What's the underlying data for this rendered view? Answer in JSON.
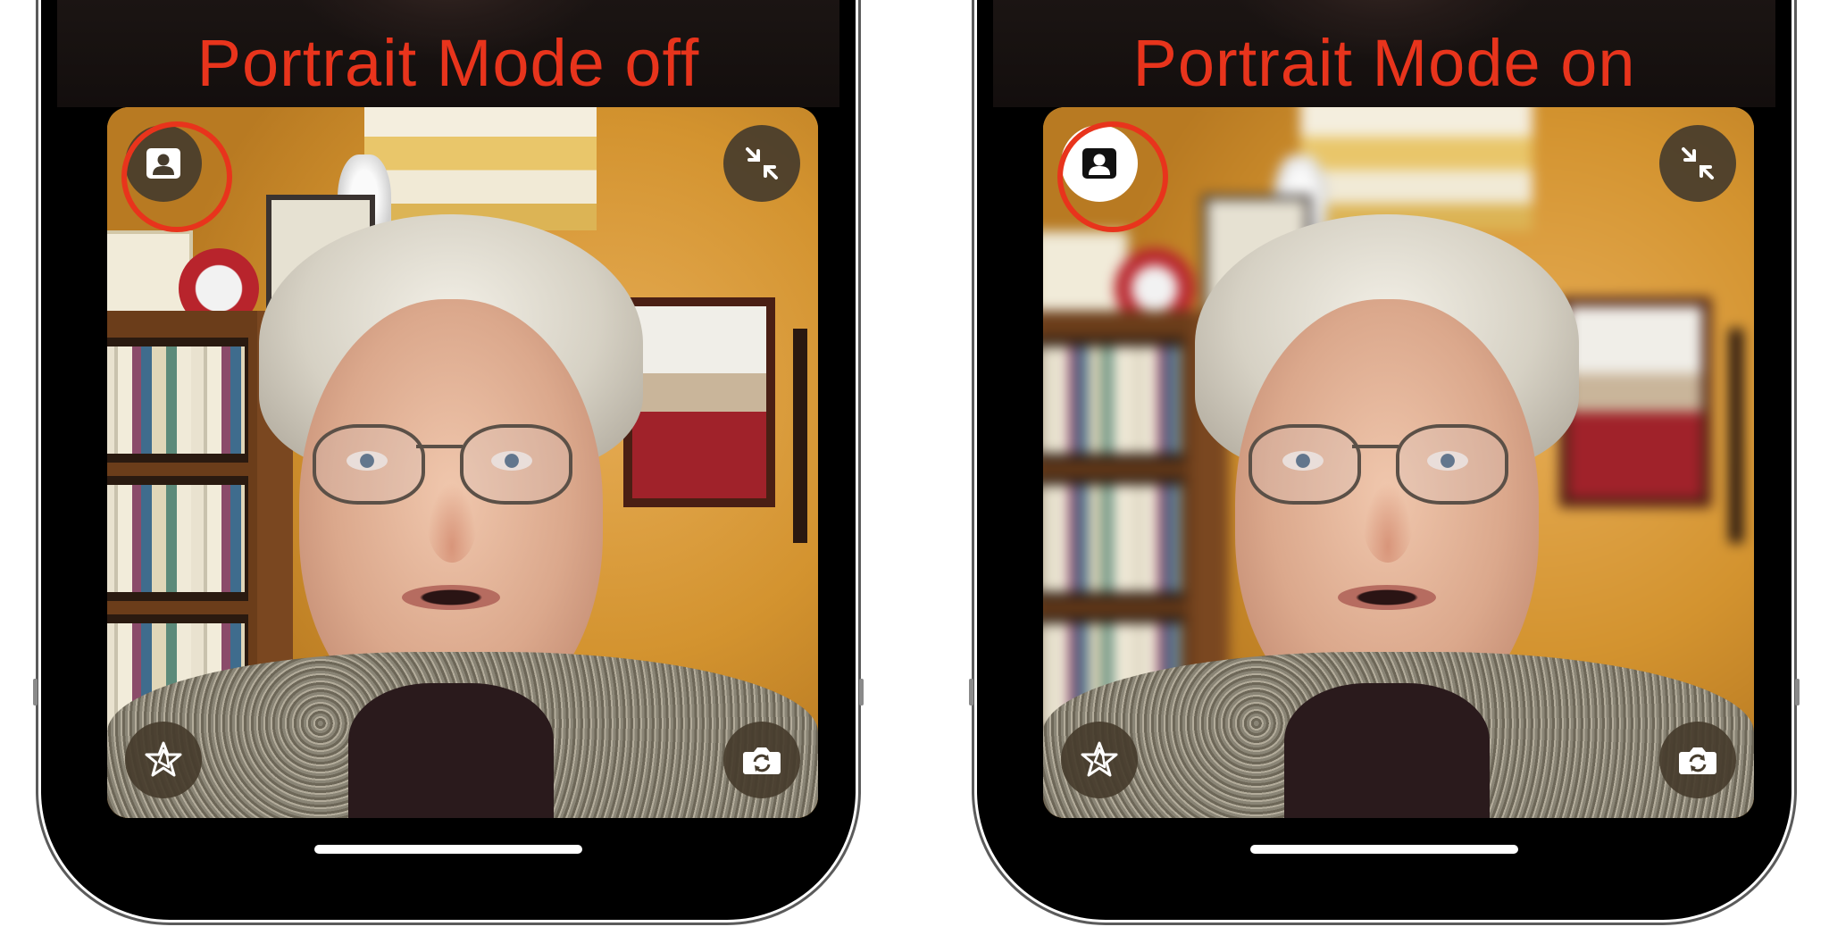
{
  "panels": [
    {
      "label": "Portrait Mode off",
      "portrait_active": false,
      "controls": {
        "portrait": "portrait-person-icon",
        "minimize": "minimize-arrows-icon",
        "effects": "effects-star-icon",
        "flip": "camera-flip-icon"
      }
    },
    {
      "label": "Portrait Mode on",
      "portrait_active": true,
      "controls": {
        "portrait": "portrait-person-icon",
        "minimize": "minimize-arrows-icon",
        "effects": "effects-star-icon",
        "flip": "camera-flip-icon"
      }
    }
  ],
  "colors": {
    "label_red": "#e8341c",
    "control_bg": "#463c2d",
    "control_active_bg": "#ffffff"
  }
}
